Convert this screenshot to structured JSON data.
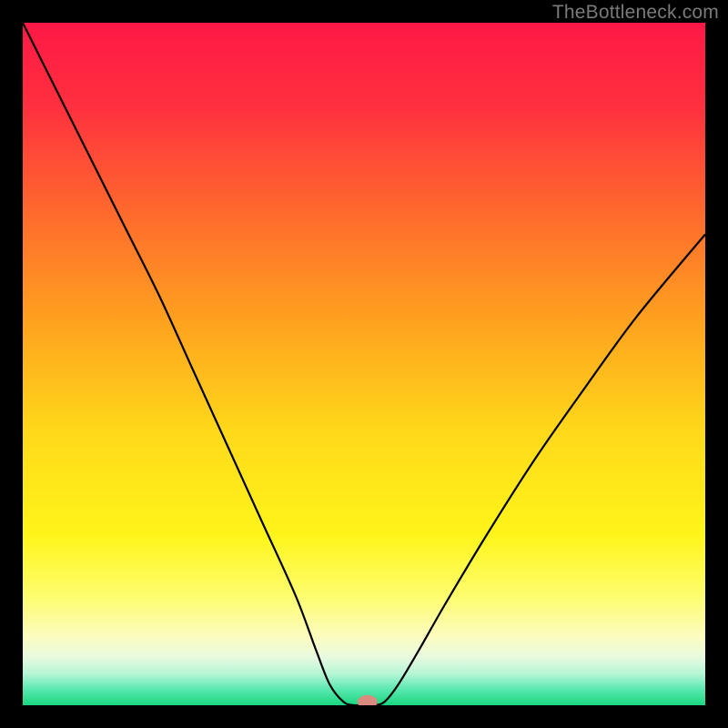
{
  "watermark": "TheBottleneck.com",
  "chart_data": {
    "type": "line",
    "title": "",
    "xlabel": "",
    "ylabel": "",
    "xlim": [
      0,
      100
    ],
    "ylim": [
      0,
      100
    ],
    "grid": false,
    "series": [
      {
        "name": "bottleneck-curve",
        "x": [
          0,
          5,
          10,
          15,
          20,
          25,
          30,
          35,
          40,
          43,
          45,
          47,
          48.5,
          50,
          51.5,
          53,
          55,
          58,
          62,
          68,
          75,
          82,
          90,
          100
        ],
        "values": [
          100,
          90,
          80,
          70,
          60,
          49,
          38,
          27,
          16,
          8,
          3,
          0.5,
          0,
          0,
          0,
          0.5,
          3,
          8,
          15,
          25,
          36,
          46,
          57,
          69
        ]
      }
    ],
    "marker": {
      "x": 50.5,
      "y": 0.5,
      "color": "#d98b7f"
    },
    "gradient_stops": [
      {
        "offset": 0.0,
        "color": "#ff1846"
      },
      {
        "offset": 0.12,
        "color": "#ff2f3f"
      },
      {
        "offset": 0.28,
        "color": "#ff6a2d"
      },
      {
        "offset": 0.45,
        "color": "#ffa61e"
      },
      {
        "offset": 0.6,
        "color": "#ffd91a"
      },
      {
        "offset": 0.75,
        "color": "#fff51a"
      },
      {
        "offset": 0.84,
        "color": "#fdfd6e"
      },
      {
        "offset": 0.9,
        "color": "#fcfcc0"
      },
      {
        "offset": 0.93,
        "color": "#e7fae0"
      },
      {
        "offset": 0.955,
        "color": "#b3f5d5"
      },
      {
        "offset": 0.975,
        "color": "#5fe9b2"
      },
      {
        "offset": 1.0,
        "color": "#18d880"
      }
    ]
  }
}
